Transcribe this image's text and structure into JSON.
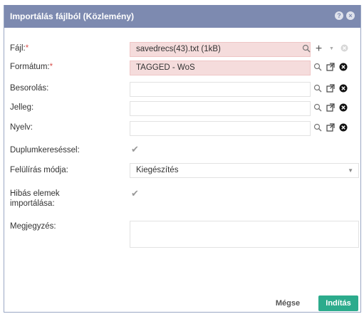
{
  "dialog": {
    "title": "Importálás fájlból (Közlemény)"
  },
  "fields": {
    "file": {
      "label": "Fájl:",
      "required": "*",
      "value": "savedrecs(43).txt (1kB)"
    },
    "format": {
      "label": "Formátum:",
      "required": "*",
      "value": "TAGGED - WoS"
    },
    "classification": {
      "label": "Besorolás:",
      "value": ""
    },
    "character": {
      "label": "Jelleg:",
      "value": ""
    },
    "language": {
      "label": "Nyelv:",
      "value": ""
    },
    "duplicate_search": {
      "label": "Duplumkereséssel:",
      "checked": true
    },
    "overwrite_mode": {
      "label": "Felülírás módja:",
      "value": "Kiegészítés"
    },
    "import_faulty": {
      "label": "Hibás elemek importálása:",
      "checked": true
    },
    "note": {
      "label": "Megjegyzés:",
      "value": ""
    }
  },
  "buttons": {
    "cancel": "Mégse",
    "start": "Indítás"
  },
  "colors": {
    "titlebar": "#7d8ab0",
    "error_field": "#f5dcdc",
    "primary_button": "#2cab8c"
  }
}
